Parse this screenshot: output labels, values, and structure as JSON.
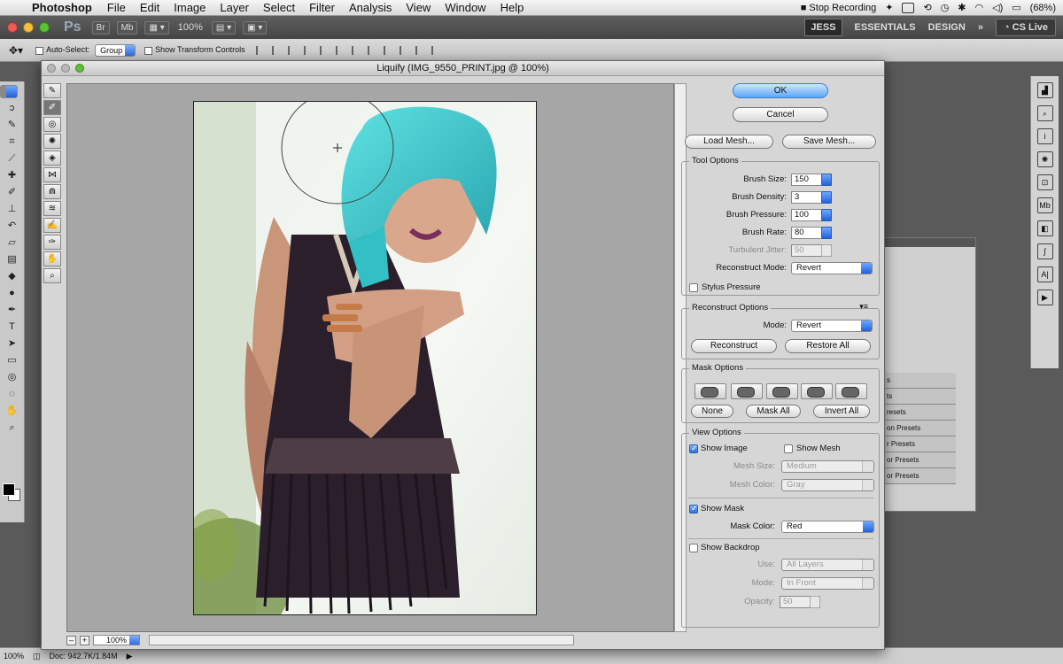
{
  "menubar": {
    "app_name": "Photoshop",
    "items": [
      "File",
      "Edit",
      "Image",
      "Layer",
      "Select",
      "Filter",
      "Analysis",
      "View",
      "Window",
      "Help"
    ],
    "stop_recording": "Stop Recording",
    "battery": "(68%)"
  },
  "appbar": {
    "logo": "Ps",
    "br": "Br",
    "mb": "Mb",
    "zoom": "100%",
    "workspace_active": "JESS",
    "workspace_essentials": "ESSENTIALS",
    "workspace_design": "DESIGN",
    "more": "»",
    "cs_live": "CS Live"
  },
  "optionsbar": {
    "auto_select_label": "Auto-Select:",
    "auto_select_value": "Group",
    "show_transform_label": "Show Transform Controls"
  },
  "dialog": {
    "title": "Liquify (IMG_9550_PRINT.jpg @ 100%)",
    "zoom": "100%",
    "ok": "OK",
    "cancel": "Cancel",
    "load_mesh": "Load Mesh...",
    "save_mesh": "Save Mesh...",
    "tool_options": {
      "title": "Tool Options",
      "brush_size_label": "Brush Size:",
      "brush_size": "150",
      "brush_density_label": "Brush Density:",
      "brush_density": "3",
      "brush_pressure_label": "Brush Pressure:",
      "brush_pressure": "100",
      "brush_rate_label": "Brush Rate:",
      "brush_rate": "80",
      "turbulent_jitter_label": "Turbulent Jitter:",
      "turbulent_jitter": "50",
      "reconstruct_mode_label": "Reconstruct Mode:",
      "reconstruct_mode": "Revert",
      "stylus_pressure": "Stylus Pressure"
    },
    "reconstruct_options": {
      "title": "Reconstruct Options",
      "mode_label": "Mode:",
      "mode": "Revert",
      "reconstruct": "Reconstruct",
      "restore_all": "Restore All"
    },
    "mask_options": {
      "title": "Mask Options",
      "none": "None",
      "mask_all": "Mask All",
      "invert_all": "Invert All"
    },
    "view_options": {
      "title": "View Options",
      "show_image": "Show Image",
      "show_image_checked": true,
      "show_mesh": "Show Mesh",
      "show_mesh_checked": false,
      "mesh_size_label": "Mesh Size:",
      "mesh_size": "Medium",
      "mesh_color_label": "Mesh Color:",
      "mesh_color": "Gray",
      "show_mask": "Show Mask",
      "show_mask_checked": true,
      "mask_color_label": "Mask Color:",
      "mask_color": "Red",
      "show_backdrop": "Show Backdrop",
      "show_backdrop_checked": false,
      "use_label": "Use:",
      "use": "All Layers",
      "mode_label": "Mode:",
      "mode": "In Front",
      "opacity_label": "Opacity:",
      "opacity": "50"
    }
  },
  "bg_panel_rows": [
    "s",
    "ts",
    "resets",
    "on Presets",
    "r Presets",
    "or Presets",
    "or Presets"
  ],
  "statusbar": {
    "zoom": "100%",
    "doc": "Doc: 942.7K/1.84M"
  },
  "colors": {
    "accent_blue": "#2f6ee0",
    "hair_cyan": "#3ec9cc"
  }
}
